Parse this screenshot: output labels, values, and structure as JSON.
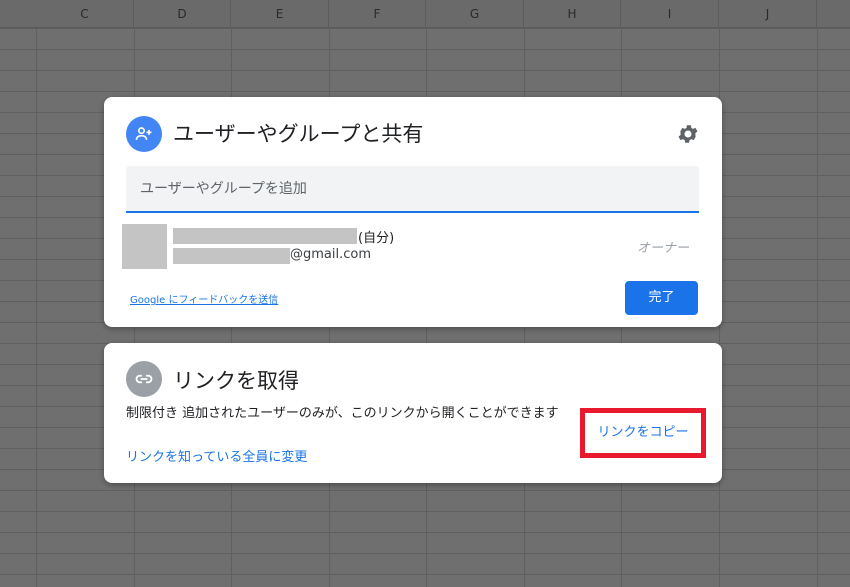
{
  "spreadsheet": {
    "columns": [
      "C",
      "D",
      "E",
      "F",
      "G",
      "H",
      "I",
      "J"
    ]
  },
  "share_dialog": {
    "title": "ユーザーやグループと共有",
    "add_placeholder": "ユーザーやグループを追加",
    "person": {
      "self_label": "(自分)",
      "email_suffix": "@gmail.com",
      "role": "オーナー"
    },
    "feedback_link": "Google にフィードバックを送信",
    "done_button": "完了"
  },
  "link_dialog": {
    "title": "リンクを取得",
    "restriction_text": "制限付き 追加されたユーザーのみが、このリンクから開くことができます",
    "change_link": "リンクを知っている全員に変更",
    "copy_button": "リンクをコピー"
  },
  "colors": {
    "accent": "#1a73e8",
    "highlight": "#e8192c"
  }
}
